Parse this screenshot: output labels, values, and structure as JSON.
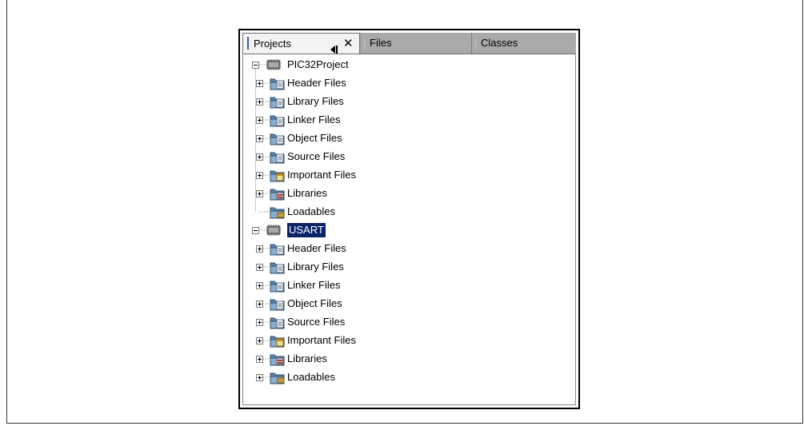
{
  "tabs": {
    "projects": "Projects",
    "files": "Files",
    "classes": "Classes"
  },
  "icons": {
    "close": "✕",
    "minimize": "minimize-icon"
  },
  "projects": [
    {
      "name": "PIC32Project",
      "selected": false,
      "folders": [
        "Header Files",
        "Library Files",
        "Linker Files",
        "Object Files",
        "Source Files",
        "Important Files",
        "Libraries",
        "Loadables"
      ]
    },
    {
      "name": "USART",
      "selected": true,
      "folders": [
        "Header Files",
        "Library Files",
        "Linker Files",
        "Object Files",
        "Source Files",
        "Important Files",
        "Libraries",
        "Loadables"
      ]
    }
  ],
  "colors": {
    "selection": "#0a246a",
    "folder": "#4a7fb0",
    "tabbar": "#9e9e9e"
  }
}
